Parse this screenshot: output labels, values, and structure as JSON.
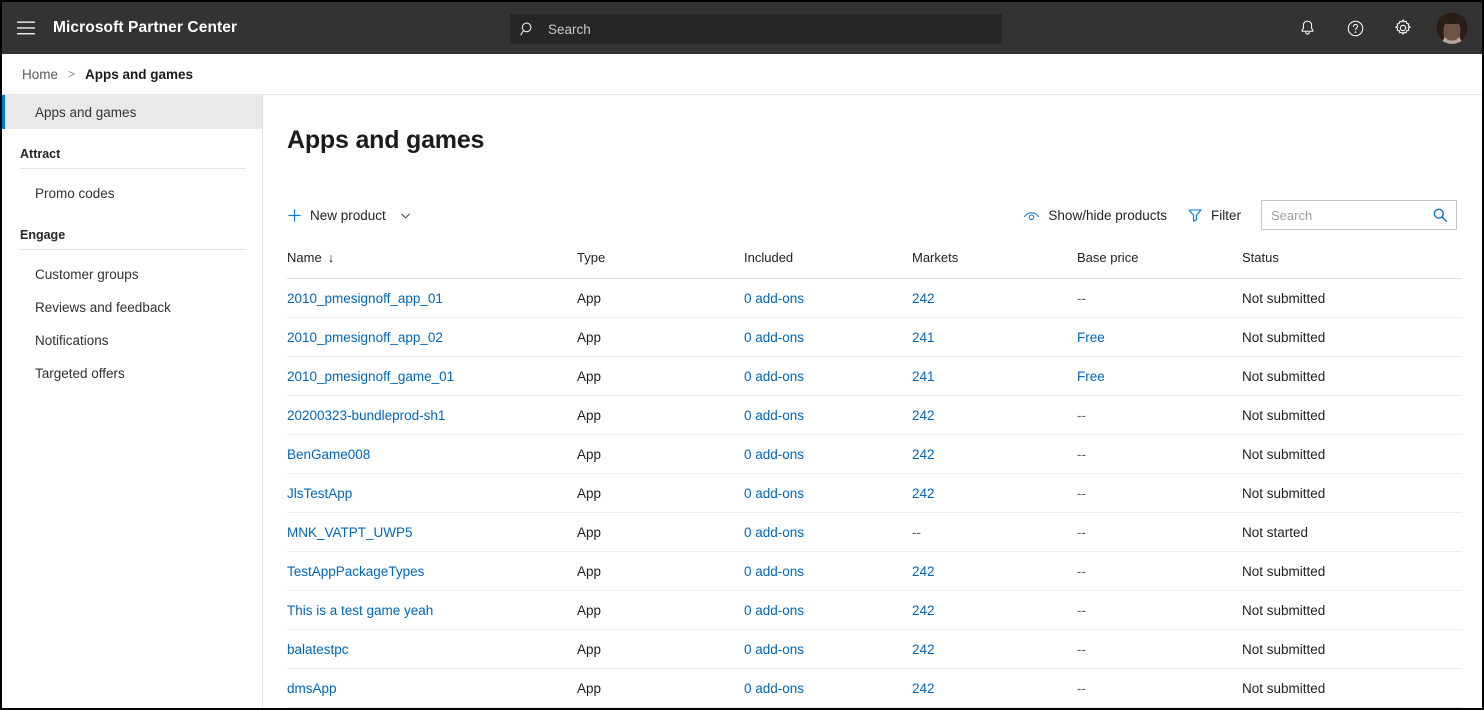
{
  "header": {
    "menu_icon": "hamburger-icon",
    "brand": "Microsoft Partner Center",
    "search_placeholder": "Search",
    "search_icon": "search-icon",
    "icons": [
      {
        "name": "notifications-bell-icon",
        "label": "Notifications"
      },
      {
        "name": "help-icon",
        "label": "Help"
      },
      {
        "name": "settings-gear-icon",
        "label": "Settings"
      }
    ],
    "avatar_label": "Account manager",
    "bg_color": "#333333",
    "search_bg_color": "#262626"
  },
  "breadcrumb": {
    "home": "Home",
    "separator": ">",
    "current": "Apps and games"
  },
  "sidebar": {
    "active_item": "Apps and games",
    "accent_color": "#0078d4",
    "active_bg_color": "#e9e9e9",
    "groups": [
      {
        "title": "Attract",
        "items": [
          {
            "label": "Promo codes"
          }
        ]
      },
      {
        "title": "Engage",
        "items": [
          {
            "label": "Customer groups"
          },
          {
            "label": "Reviews and feedback"
          },
          {
            "label": "Notifications"
          },
          {
            "label": "Targeted offers"
          }
        ]
      }
    ]
  },
  "main": {
    "page_title": "Apps and games",
    "toolbar": {
      "new_product_label": "New product",
      "new_product_icon": "plus-icon",
      "new_product_chevron": "chevron-down-icon",
      "show_hide_label": "Show/hide products",
      "show_hide_icon": "hide-eye-icon",
      "filter_label": "Filter",
      "filter_icon": "funnel-icon",
      "search_placeholder": "Search",
      "search_icon": "search-icon"
    },
    "table": {
      "columns": [
        {
          "key": "name",
          "label": "Name",
          "sorted": "asc",
          "sort_glyph": "↓"
        },
        {
          "key": "type",
          "label": "Type"
        },
        {
          "key": "included",
          "label": "Included"
        },
        {
          "key": "markets",
          "label": "Markets"
        },
        {
          "key": "base_price",
          "label": "Base price"
        },
        {
          "key": "status",
          "label": "Status"
        }
      ],
      "rows": [
        {
          "name": "2010_pmesignoff_app_01",
          "type": "App",
          "included": "0 add-ons",
          "markets": "242",
          "base_price": "--",
          "status": "Not submitted"
        },
        {
          "name": "2010_pmesignoff_app_02",
          "type": "App",
          "included": "0 add-ons",
          "markets": "241",
          "base_price": "Free",
          "status": "Not submitted"
        },
        {
          "name": "2010_pmesignoff_game_01",
          "type": "App",
          "included": "0 add-ons",
          "markets": "241",
          "base_price": "Free",
          "status": "Not submitted"
        },
        {
          "name": "20200323-bundleprod-sh1",
          "type": "App",
          "included": "0 add-ons",
          "markets": "242",
          "base_price": "--",
          "status": "Not submitted"
        },
        {
          "name": "BenGame008",
          "type": "App",
          "included": "0 add-ons",
          "markets": "242",
          "base_price": "--",
          "status": "Not submitted"
        },
        {
          "name": "JlsTestApp",
          "type": "App",
          "included": "0 add-ons",
          "markets": "242",
          "base_price": "--",
          "status": "Not submitted"
        },
        {
          "name": "MNK_VATPT_UWP5",
          "type": "App",
          "included": "0 add-ons",
          "markets": "--",
          "base_price": "--",
          "status": "Not started"
        },
        {
          "name": "TestAppPackageTypes",
          "type": "App",
          "included": "0 add-ons",
          "markets": "242",
          "base_price": "--",
          "status": "Not submitted"
        },
        {
          "name": "This is a test game yeah",
          "type": "App",
          "included": "0 add-ons",
          "markets": "242",
          "base_price": "--",
          "status": "Not submitted"
        },
        {
          "name": "balatestpc",
          "type": "App",
          "included": "0 add-ons",
          "markets": "242",
          "base_price": "--",
          "status": "Not submitted"
        },
        {
          "name": "dmsApp",
          "type": "App",
          "included": "0 add-ons",
          "markets": "242",
          "base_price": "--",
          "status": "Not submitted"
        }
      ]
    }
  },
  "colors": {
    "link": "#0067b8",
    "accent": "#0078d4",
    "text": "#201f1e",
    "muted": "#605e5c"
  }
}
